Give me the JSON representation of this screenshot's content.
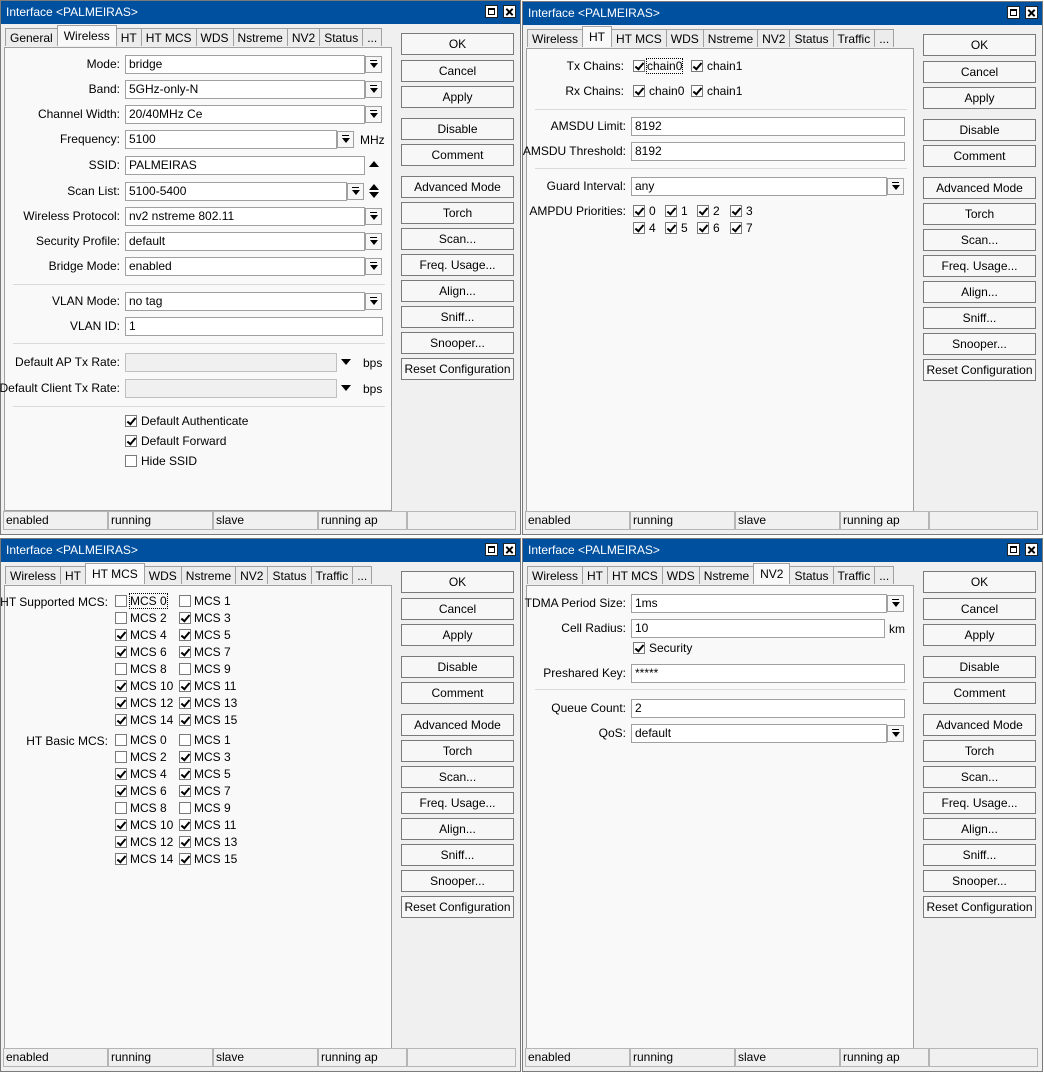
{
  "windows": [
    {
      "title": "Interface <PALMEIRAS>",
      "tabs": [
        "General",
        "Wireless",
        "HT",
        "HT MCS",
        "WDS",
        "Nstreme",
        "NV2",
        "Status",
        "..."
      ],
      "active_tab": "Wireless",
      "fields": {
        "mode": {
          "label": "Mode:",
          "value": "bridge"
        },
        "band": {
          "label": "Band:",
          "value": "5GHz-only-N"
        },
        "channel_width": {
          "label": "Channel Width:",
          "value": "20/40MHz Ce"
        },
        "frequency": {
          "label": "Frequency:",
          "value": "5100",
          "unit": "MHz"
        },
        "ssid": {
          "label": "SSID:",
          "value": "PALMEIRAS"
        },
        "scan_list": {
          "label": "Scan List:",
          "value": "5100-5400"
        },
        "wireless_protocol": {
          "label": "Wireless Protocol:",
          "value": "nv2 nstreme 802.11"
        },
        "security_profile": {
          "label": "Security Profile:",
          "value": "default"
        },
        "bridge_mode": {
          "label": "Bridge Mode:",
          "value": "enabled"
        },
        "vlan_mode": {
          "label": "VLAN Mode:",
          "value": "no tag"
        },
        "vlan_id": {
          "label": "VLAN ID:",
          "value": "1"
        },
        "ap_tx_rate": {
          "label": "Default AP Tx Rate:",
          "value": "",
          "unit": "bps"
        },
        "client_tx_rate": {
          "label": "Default Client Tx Rate:",
          "value": "",
          "unit": "bps"
        }
      },
      "checkboxes": [
        {
          "label": "Default Authenticate",
          "checked": true
        },
        {
          "label": "Default Forward",
          "checked": true
        },
        {
          "label": "Hide SSID",
          "checked": false
        }
      ],
      "status": [
        "enabled",
        "running",
        "slave",
        "running ap",
        ""
      ]
    },
    {
      "title": "Interface <PALMEIRAS>",
      "tabs": [
        "Wireless",
        "HT",
        "HT MCS",
        "WDS",
        "Nstreme",
        "NV2",
        "Status",
        "Traffic",
        "..."
      ],
      "active_tab": "HT",
      "tx_chains": {
        "label": "Tx Chains:",
        "items": [
          {
            "label": "chain0",
            "checked": true
          },
          {
            "label": "chain1",
            "checked": true
          }
        ]
      },
      "rx_chains": {
        "label": "Rx Chains:",
        "items": [
          {
            "label": "chain0",
            "checked": true
          },
          {
            "label": "chain1",
            "checked": true
          }
        ]
      },
      "amsdu_limit": {
        "label": "AMSDU Limit:",
        "value": "8192"
      },
      "amsdu_threshold": {
        "label": "AMSDU Threshold:",
        "value": "8192"
      },
      "guard_interval": {
        "label": "Guard Interval:",
        "value": "any"
      },
      "ampdu_priorities": {
        "label": "AMPDU Priorities:",
        "items": [
          "0",
          "1",
          "2",
          "3",
          "4",
          "5",
          "6",
          "7"
        ]
      },
      "status": [
        "enabled",
        "running",
        "slave",
        "running ap",
        ""
      ]
    },
    {
      "title": "Interface <PALMEIRAS>",
      "tabs": [
        "Wireless",
        "HT",
        "HT MCS",
        "WDS",
        "Nstreme",
        "NV2",
        "Status",
        "Traffic",
        "..."
      ],
      "active_tab": "HT MCS",
      "supported_label": "HT Supported MCS:",
      "basic_label": "HT Basic MCS:",
      "supported": [
        {
          "label": "MCS 0",
          "checked": false
        },
        {
          "label": "MCS 1",
          "checked": false
        },
        {
          "label": "MCS 2",
          "checked": false
        },
        {
          "label": "MCS 3",
          "checked": true
        },
        {
          "label": "MCS 4",
          "checked": true
        },
        {
          "label": "MCS 5",
          "checked": true
        },
        {
          "label": "MCS 6",
          "checked": true
        },
        {
          "label": "MCS 7",
          "checked": true
        },
        {
          "label": "MCS 8",
          "checked": false
        },
        {
          "label": "MCS 9",
          "checked": false
        },
        {
          "label": "MCS 10",
          "checked": true
        },
        {
          "label": "MCS 11",
          "checked": true
        },
        {
          "label": "MCS 12",
          "checked": true
        },
        {
          "label": "MCS 13",
          "checked": true
        },
        {
          "label": "MCS 14",
          "checked": true
        },
        {
          "label": "MCS 15",
          "checked": true
        }
      ],
      "basic": [
        {
          "label": "MCS 0",
          "checked": false
        },
        {
          "label": "MCS 1",
          "checked": false
        },
        {
          "label": "MCS 2",
          "checked": false
        },
        {
          "label": "MCS 3",
          "checked": true
        },
        {
          "label": "MCS 4",
          "checked": true
        },
        {
          "label": "MCS 5",
          "checked": true
        },
        {
          "label": "MCS 6",
          "checked": true
        },
        {
          "label": "MCS 7",
          "checked": true
        },
        {
          "label": "MCS 8",
          "checked": false
        },
        {
          "label": "MCS 9",
          "checked": false
        },
        {
          "label": "MCS 10",
          "checked": true
        },
        {
          "label": "MCS 11",
          "checked": true
        },
        {
          "label": "MCS 12",
          "checked": true
        },
        {
          "label": "MCS 13",
          "checked": true
        },
        {
          "label": "MCS 14",
          "checked": true
        },
        {
          "label": "MCS 15",
          "checked": true
        }
      ],
      "status": [
        "enabled",
        "running",
        "slave",
        "running ap",
        ""
      ]
    },
    {
      "title": "Interface <PALMEIRAS>",
      "tabs": [
        "Wireless",
        "HT",
        "HT MCS",
        "WDS",
        "Nstreme",
        "NV2",
        "Status",
        "Traffic",
        "..."
      ],
      "active_tab": "NV2",
      "tdma_period": {
        "label": "TDMA Period Size:",
        "value": "1ms"
      },
      "cell_radius": {
        "label": "Cell Radius:",
        "value": "10",
        "unit": "km"
      },
      "security": {
        "label": "Security",
        "checked": true
      },
      "preshared_key": {
        "label": "Preshared Key:",
        "value": "*****"
      },
      "queue_count": {
        "label": "Queue Count:",
        "value": "2"
      },
      "qos": {
        "label": "QoS:",
        "value": "default"
      },
      "status": [
        "enabled",
        "running",
        "slave",
        "running ap",
        ""
      ]
    }
  ],
  "buttons": [
    "OK",
    "Cancel",
    "Apply",
    "Disable",
    "Comment",
    "Advanced Mode",
    "Torch",
    "Scan...",
    "Freq. Usage...",
    "Align...",
    "Sniff...",
    "Snooper...",
    "Reset Configuration"
  ],
  "colors": {
    "titlebar": "#0050a0",
    "window_bg": "#f0f0f0",
    "panel_bg": "#f9f9f9"
  }
}
